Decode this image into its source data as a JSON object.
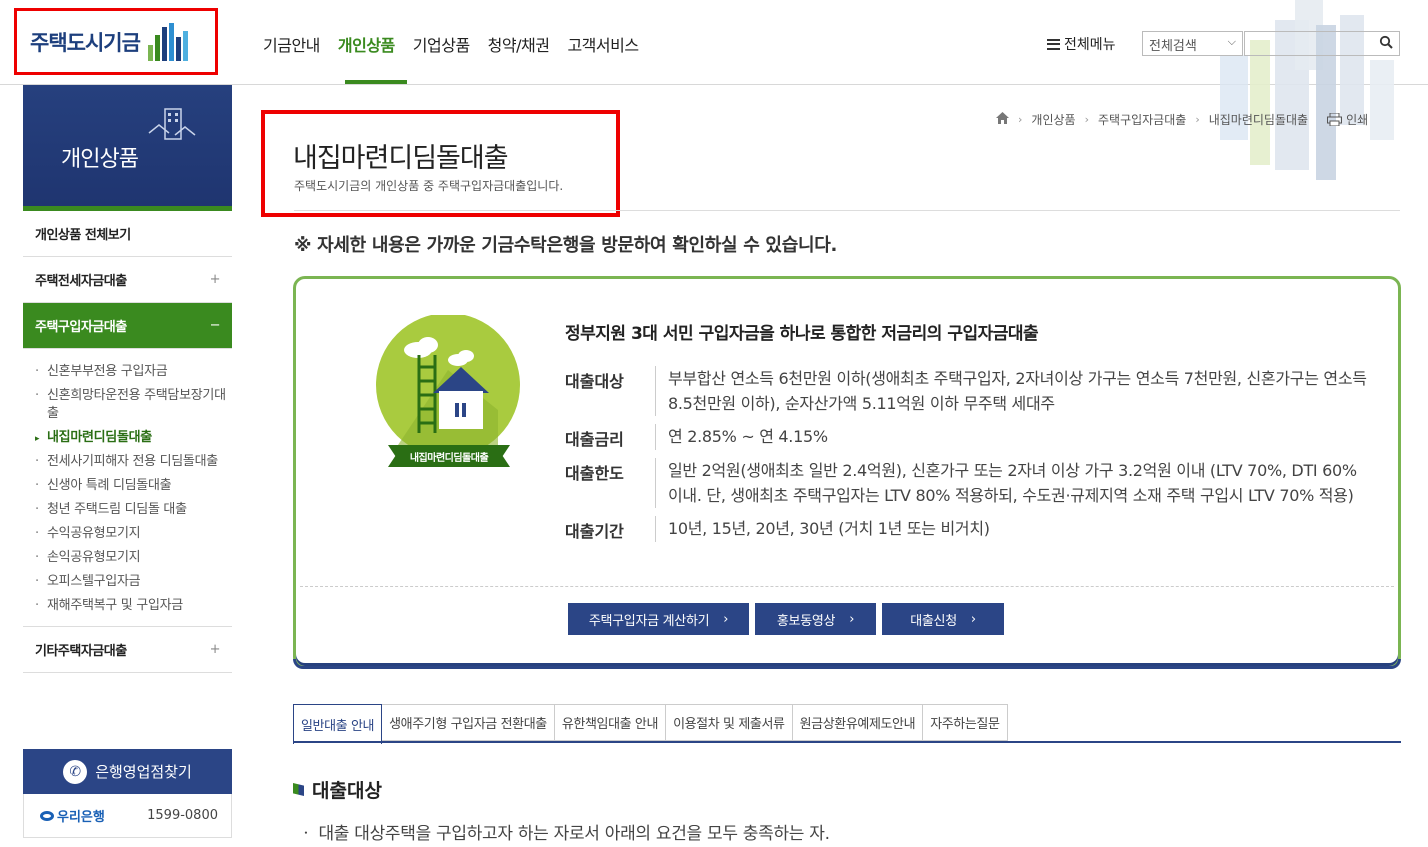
{
  "header": {
    "logo_text": "주택도시기금",
    "nav": [
      "기금안내",
      "개인상품",
      "기업상품",
      "청약/채권",
      "고객서비스"
    ],
    "all_menu": "전체메뉴",
    "search_select": "전체검색",
    "search_placeholder": ""
  },
  "sidebar": {
    "title": "개인상품",
    "items": [
      {
        "label": "개인상품 전체보기",
        "toggle": ""
      },
      {
        "label": "주택전세자금대출",
        "toggle": "+"
      },
      {
        "label": "주택구입자금대출",
        "toggle": "−"
      }
    ],
    "sub_items": [
      "신혼부부전용 구입자금",
      "신혼희망타운전용 주택담보장기대출",
      "내집마련디딤돌대출",
      "전세사기피해자 전용 디딤돌대출",
      "신생아 특례 디딤돌대출",
      "청년 주택드림 디딤돌 대출",
      "수익공유형모기지",
      "손익공유형모기지",
      "오피스텔구입자금",
      "재해주택복구 및 구입자금"
    ],
    "last_item": {
      "label": "기타주택자금대출",
      "toggle": "+"
    },
    "bank_find": "은행영업점찾기",
    "bank_name": "우리은행",
    "bank_phone": "1599-0800"
  },
  "breadcrumb": [
    "개인상품",
    "주택구입자금대출",
    "내집마련디딤돌대출"
  ],
  "print_label": "인쇄",
  "page": {
    "title": "내집마련디딤돌대출",
    "desc": "주택도시기금의 개인상품 중 주택구입자금대출입니다.",
    "notice": "※ 자세한 내용은 가까운 기금수탁은행을 방문하여 확인하실 수 있습니다."
  },
  "card": {
    "emblem_label": "내집마련디딤돌대출",
    "headline": "정부지원 3대 서민 구입자금을 하나로 통합한 저금리의 구입자금대출",
    "rows": [
      {
        "label": "대출대상",
        "value": "부부합산 연소득 6천만원 이하(생애최초 주택구입자, 2자녀이상 가구는 연소득 7천만원, 신혼가구는 연소득 8.5천만원 이하), 순자산가액 5.11억원 이하 무주택 세대주"
      },
      {
        "label": "대출금리",
        "value": "연 2.85% ~ 연 4.15%"
      },
      {
        "label": "대출한도",
        "value": "일반 2억원(생애최초 일반 2.4억원), 신혼가구 또는 2자녀 이상 가구 3.2억원 이내 (LTV 70%, DTI 60% 이내. 단, 생애최초 주택구입자는 LTV 80% 적용하되, 수도권·규제지역 소재 주택 구입시 LTV 70% 적용)"
      },
      {
        "label": "대출기간",
        "value": "10년, 15년, 20년, 30년 (거치 1년 또는 비거치)"
      }
    ],
    "buttons": [
      "주택구입자금 계산하기",
      "홍보동영상",
      "대출신청"
    ]
  },
  "tabs": [
    "일반대출 안내",
    "생애주기형 구입자금 전환대출",
    "유한책임대출 안내",
    "이용절차 및 제출서류",
    "원금상환유예제도안내",
    "자주하는질문"
  ],
  "section": {
    "title": "대출대상",
    "text": "ㆍ 대출 대상주택을 구입하고자 하는 자로서 아래의 요건을 모두 충족하는 자."
  },
  "colors": {
    "brand_navy": "#2b4586",
    "brand_green": "#3a8a1f",
    "highlight_red": "#e00000"
  }
}
